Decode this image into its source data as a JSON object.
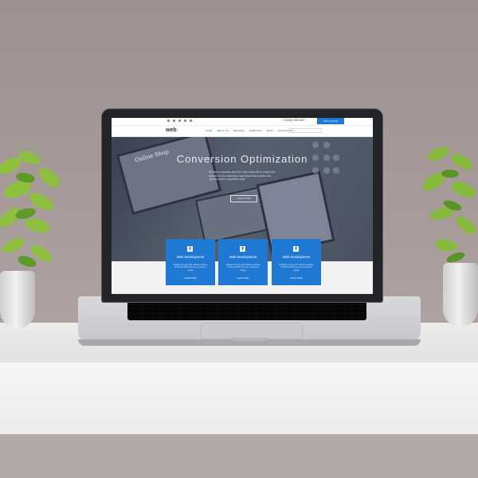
{
  "scene": {
    "description_colors": {
      "wall": "#a39796",
      "desk": "#ecebea",
      "accent_blue": "#1f78d1",
      "plant_green": "#7fb63a"
    }
  },
  "website": {
    "topbar": {
      "phone": "+1 (000) 000 000",
      "cta_label": "GET A QUOTE"
    },
    "navbar": {
      "logo": "web",
      "items": [
        {
          "label": "HOME",
          "active": true
        },
        {
          "label": "ABOUT US",
          "active": false
        },
        {
          "label": "SERVICES",
          "active": false
        },
        {
          "label": "PORTFOLIO",
          "active": false
        },
        {
          "label": "BLOG",
          "active": false
        },
        {
          "label": "CONTACT US",
          "active": false
        }
      ],
      "search_placeholder": "Search"
    },
    "hero": {
      "title": "Conversion Optimization",
      "subtitle": "We help companies discover what makes them unique and channel it into a distinctive experience that enables and optimizes their competitive edge.",
      "button_label": "LEARN MORE",
      "background_text": "Online Shop"
    },
    "cards": [
      {
        "icon": "document-icon",
        "title": "Web Development",
        "text": "Building of secure and reliable corporate HTML and PHP web user experience design",
        "link": "LEARN MORE"
      },
      {
        "icon": "document-icon",
        "title": "Web Development",
        "text": "Building of secure and reliable corporate HTML and PHP web user experience design",
        "link": "LEARN MORE"
      },
      {
        "icon": "document-icon",
        "title": "Web Development",
        "text": "Building of secure and reliable corporate HTML and PHP web user experience design",
        "link": "LEARN MORE"
      }
    ]
  }
}
